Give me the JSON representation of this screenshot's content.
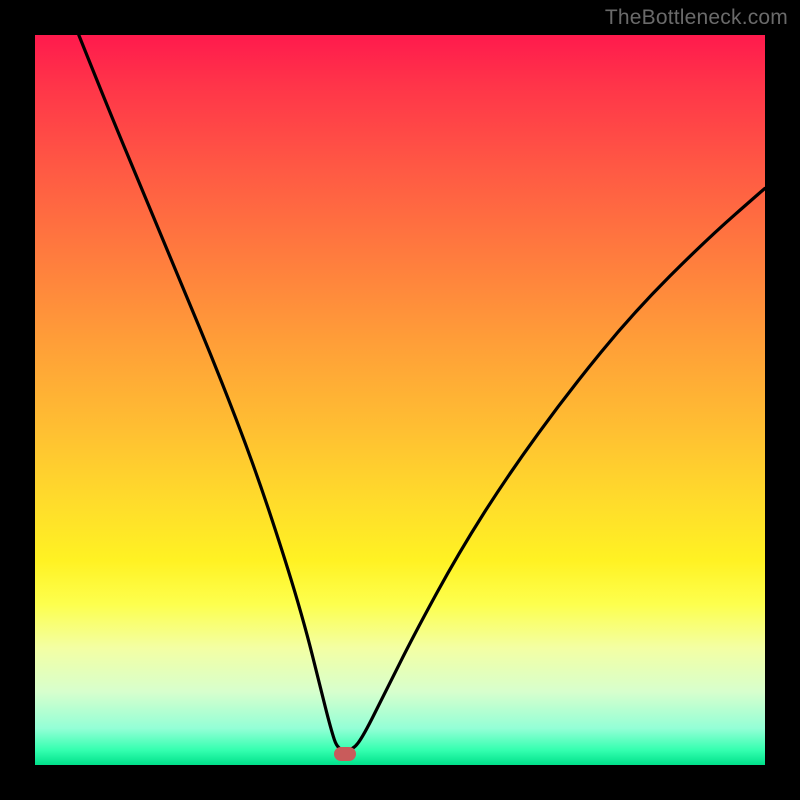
{
  "watermark": "TheBottleneck.com",
  "chart_data": {
    "type": "line",
    "title": "",
    "xlabel": "",
    "ylabel": "",
    "xlim": [
      0,
      100
    ],
    "ylim": [
      0,
      100
    ],
    "grid": false,
    "legend": false,
    "series": [
      {
        "name": "bottleneck-curve",
        "x": [
          6,
          10,
          15,
          20,
          25,
          30,
          34,
          37,
          39,
          40.5,
          41.5,
          43.5,
          45,
          48,
          52,
          58,
          65,
          73,
          82,
          92,
          100
        ],
        "y": [
          100,
          90,
          78,
          66,
          54,
          41,
          29,
          19,
          11,
          5,
          2,
          2,
          4,
          10,
          18,
          29,
          40,
          51,
          62,
          72,
          79
        ]
      }
    ],
    "marker": {
      "x": 42.5,
      "y": 1.5,
      "color": "#c95b5b"
    },
    "colors": {
      "gradient_top": "#ff1a4d",
      "gradient_mid": "#ffdc2b",
      "gradient_bottom": "#00e08a",
      "curve": "#000000",
      "background": "#000000"
    }
  }
}
